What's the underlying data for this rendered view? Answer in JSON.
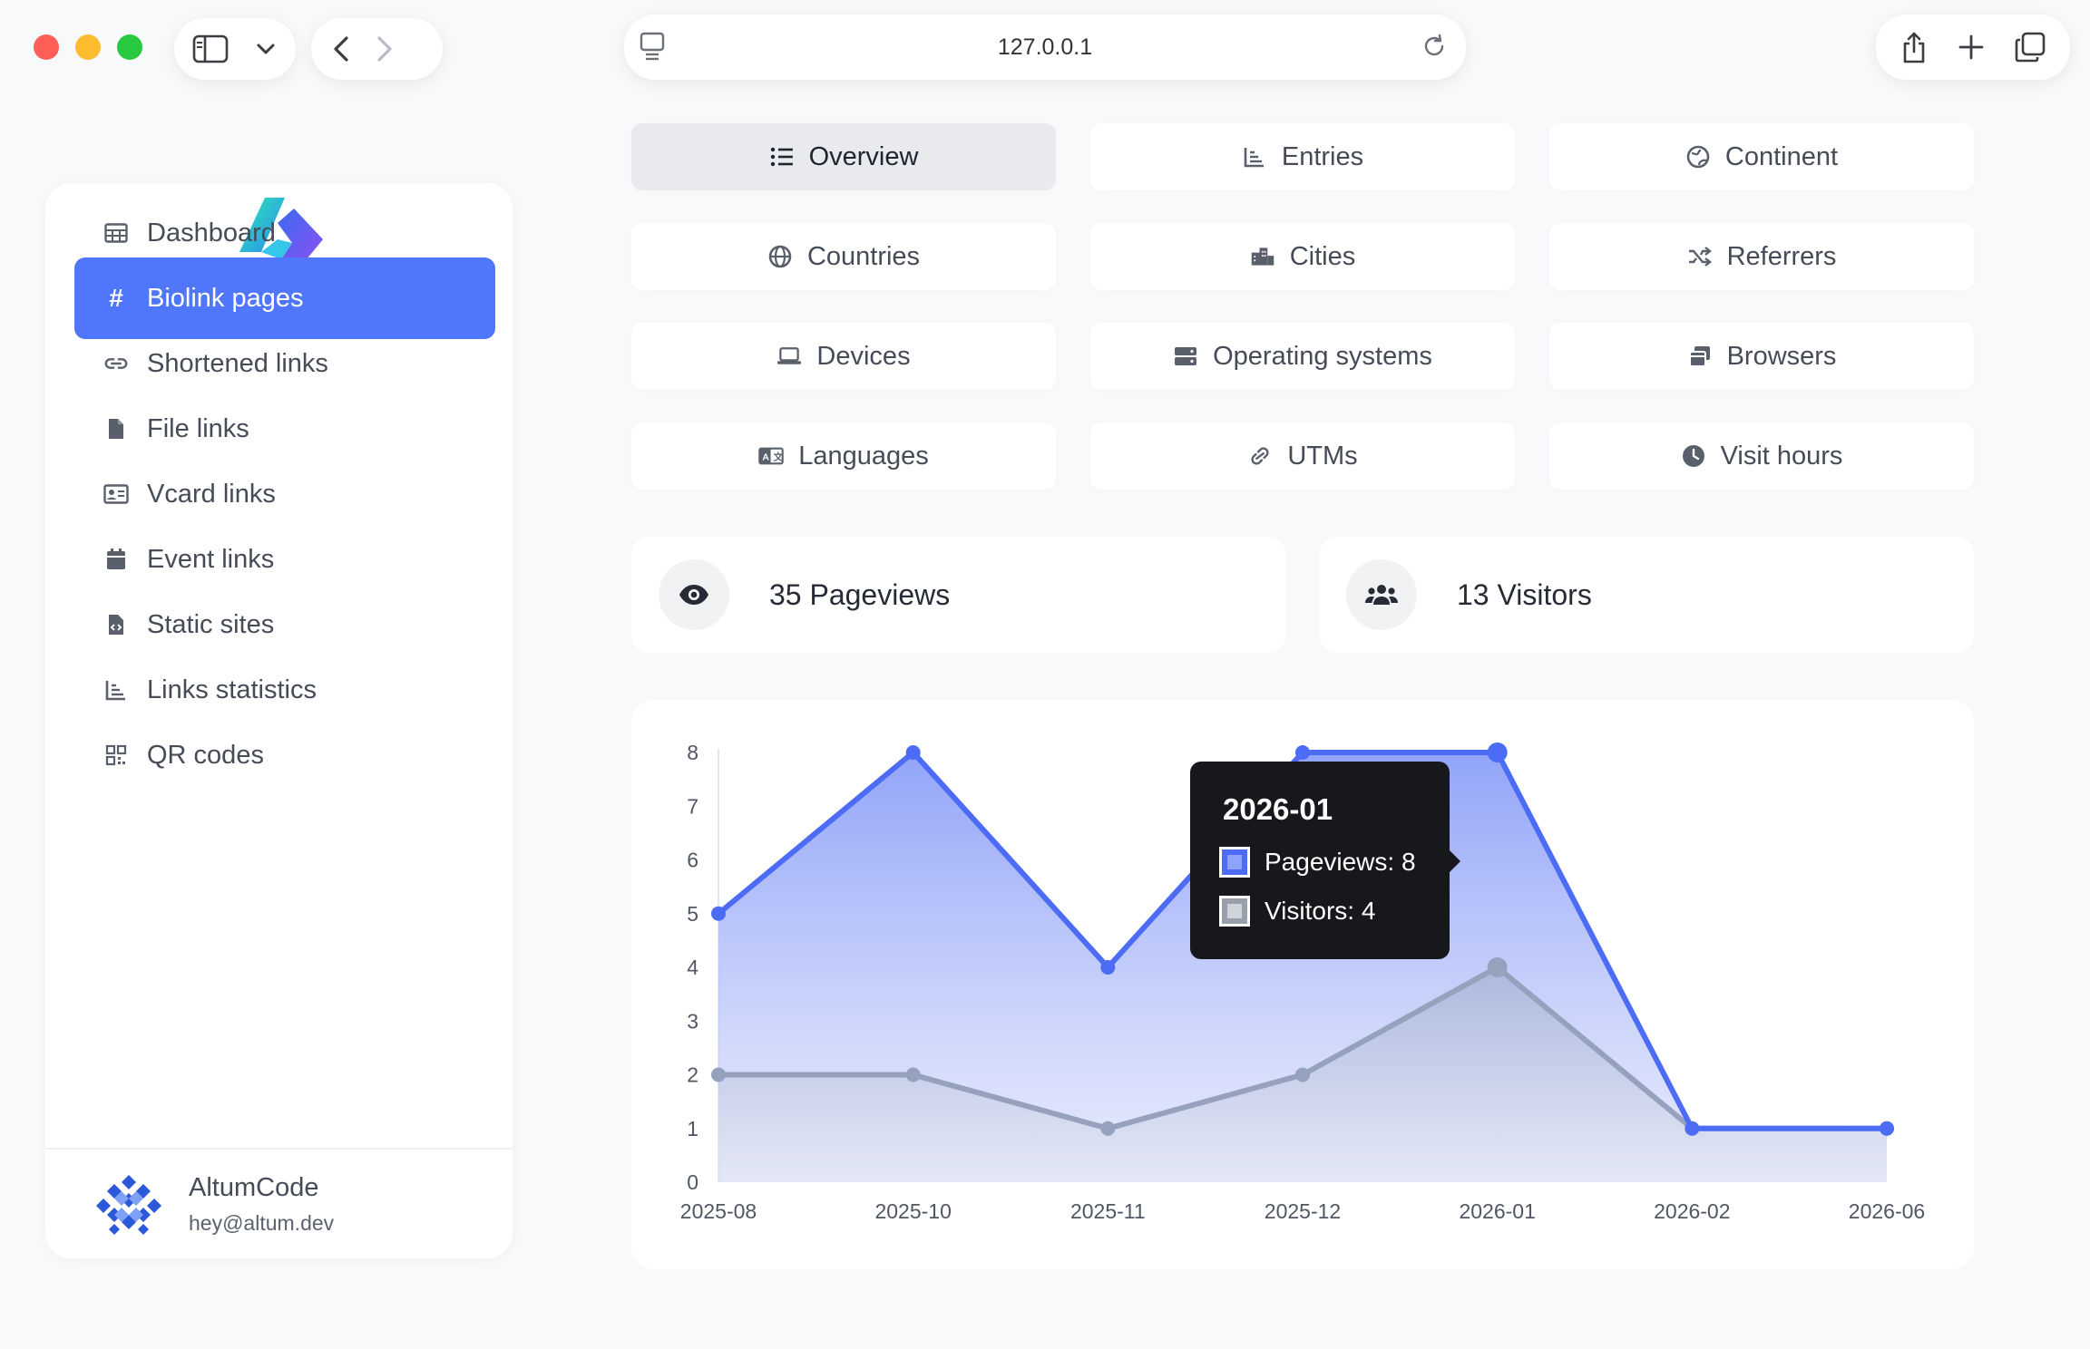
{
  "browser": {
    "url": "127.0.0.1"
  },
  "sidebar": {
    "items": [
      {
        "label": "Dashboard",
        "icon": "table-icon"
      },
      {
        "label": "Biolink pages",
        "icon": "hash-icon",
        "active": true
      },
      {
        "label": "Shortened links",
        "icon": "link-icon"
      },
      {
        "label": "File links",
        "icon": "file-icon"
      },
      {
        "label": "Vcard links",
        "icon": "id-card-icon"
      },
      {
        "label": "Event links",
        "icon": "calendar-icon"
      },
      {
        "label": "Static sites",
        "icon": "file-code-icon"
      },
      {
        "label": "Links statistics",
        "icon": "chart-icon"
      },
      {
        "label": "QR codes",
        "icon": "qr-icon"
      }
    ],
    "user": {
      "name": "AltumCode",
      "email": "hey@altum.dev"
    }
  },
  "tabs": [
    {
      "label": "Overview",
      "icon": "list-icon",
      "active": true
    },
    {
      "label": "Entries",
      "icon": "chart-icon"
    },
    {
      "label": "Continent",
      "icon": "globe-europe-icon"
    },
    {
      "label": "Countries",
      "icon": "globe-icon"
    },
    {
      "label": "Cities",
      "icon": "city-icon"
    },
    {
      "label": "Referrers",
      "icon": "random-icon"
    },
    {
      "label": "Devices",
      "icon": "laptop-icon"
    },
    {
      "label": "Operating systems",
      "icon": "server-icon"
    },
    {
      "label": "Browsers",
      "icon": "window-icon"
    },
    {
      "label": "Languages",
      "icon": "language-icon"
    },
    {
      "label": "UTMs",
      "icon": "link-icon"
    },
    {
      "label": "Visit hours",
      "icon": "clock-icon"
    }
  ],
  "stats": {
    "pageviews": "35 Pageviews",
    "visitors": "13 Visitors"
  },
  "colors": {
    "accent": "#4f76fb",
    "pageviews_line": "#4d6cf5",
    "visitors_line": "#95a1bd"
  },
  "chart_data": {
    "type": "area",
    "categories": [
      "2025-08",
      "2025-10",
      "2025-11",
      "2025-12",
      "2026-01",
      "2026-02",
      "2026-06"
    ],
    "series": [
      {
        "name": "Pageviews",
        "values": [
          5,
          8,
          4,
          8,
          8,
          1,
          1
        ]
      },
      {
        "name": "Visitors",
        "values": [
          2,
          2,
          1,
          2,
          4,
          1,
          1
        ]
      }
    ],
    "ylim": [
      0,
      8
    ],
    "yticks": [
      0,
      1,
      2,
      3,
      4,
      5,
      6,
      7,
      8
    ],
    "grid": false,
    "tooltip": {
      "title": "2026-01",
      "rows": [
        "Pageviews: 8",
        "Visitors: 4"
      ]
    }
  }
}
